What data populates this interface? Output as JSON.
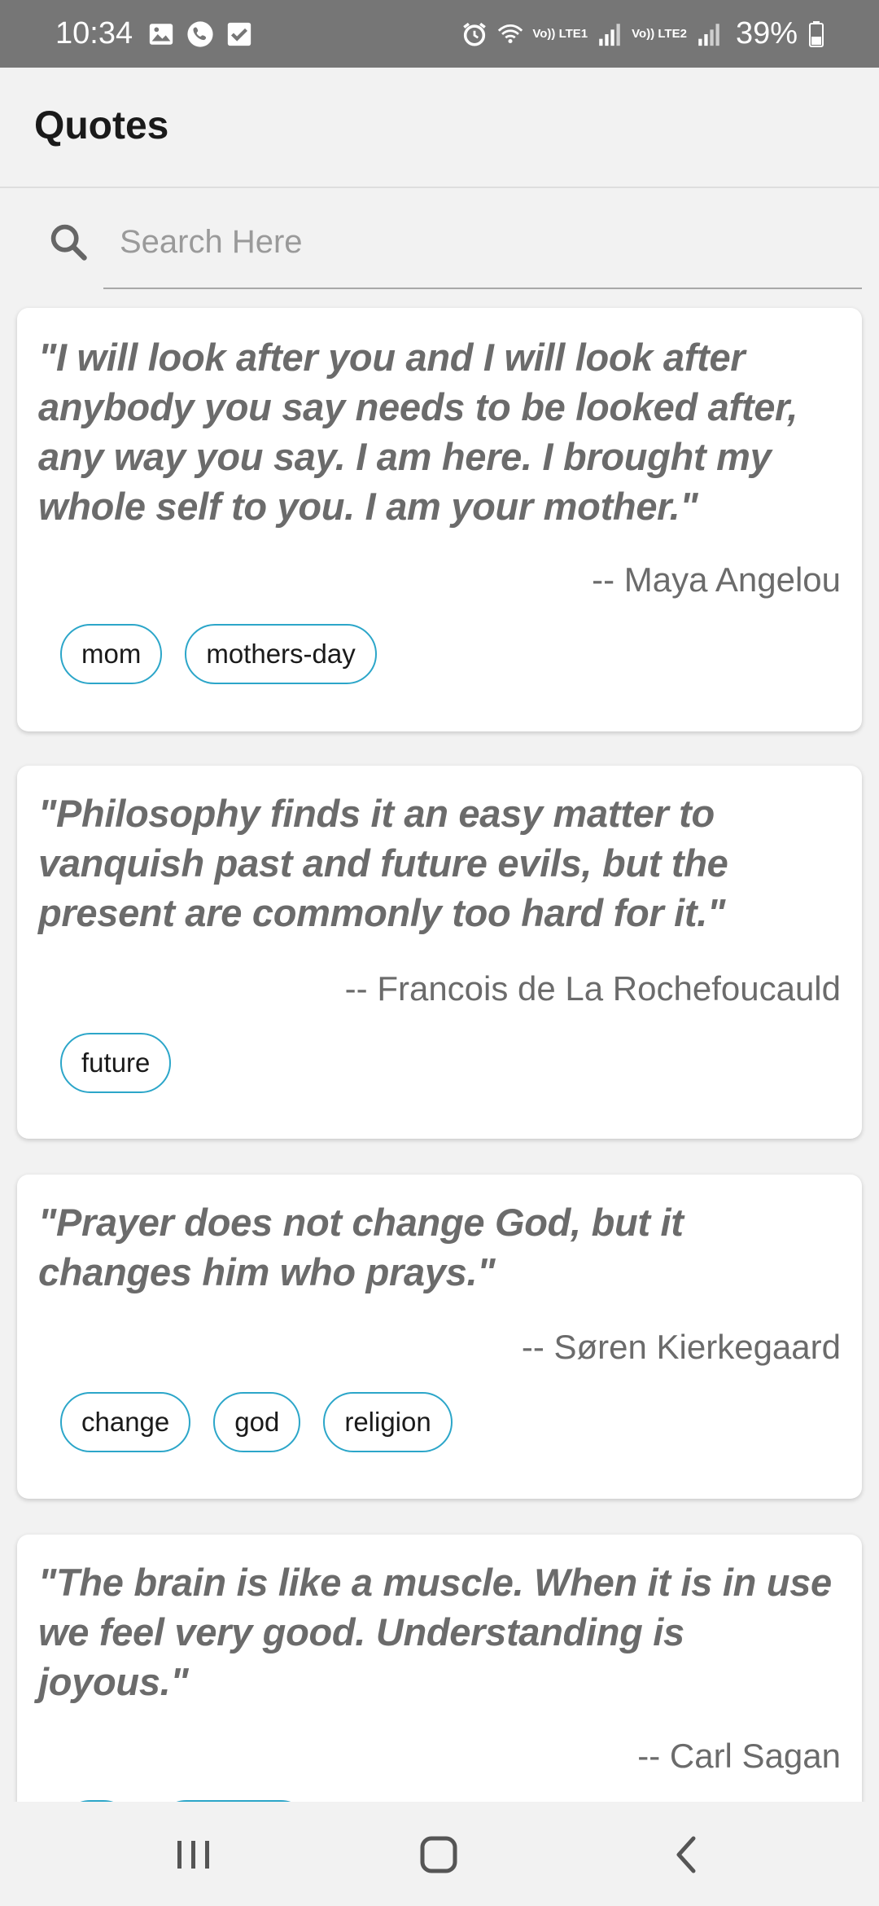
{
  "status_bar": {
    "time": "10:34",
    "net1": "Vo)) LTE1",
    "net2": "Vo)) LTE2",
    "battery": "39%"
  },
  "app_bar": {
    "title": "Quotes"
  },
  "search": {
    "placeholder": "Search Here",
    "value": ""
  },
  "quotes": [
    {
      "text": "\"I will look after you and I will look after anybody you say needs to be looked after, any way you say. I am here. I brought my whole self to you. I am your mother.\"",
      "author": "-- Maya Angelou",
      "tags": [
        "mom",
        "mothers-day"
      ]
    },
    {
      "text": "\"Philosophy finds it an easy matter to vanquish past and future evils, but the present are commonly too hard for it.\"",
      "author": "-- Francois de La Rochefoucauld",
      "tags": [
        "future"
      ]
    },
    {
      "text": "\"Prayer does not change God, but it changes him who prays.\"",
      "author": "-- Søren Kierkegaard",
      "tags": [
        "change",
        "god",
        "religion"
      ]
    },
    {
      "text": "\"The brain is like a muscle. When it is in use we feel very good. Understanding is joyous.\"",
      "author": "-- Carl Sagan",
      "tags": []
    }
  ],
  "nav": {
    "recents_icon": "recents-icon",
    "home_icon": "home-icon",
    "back_icon": "back-icon"
  },
  "colors": {
    "status_bar": "#767676",
    "tag_border": "#2ca6c9",
    "quote_text": "#6b6b6b",
    "background": "#f2f2f2"
  }
}
